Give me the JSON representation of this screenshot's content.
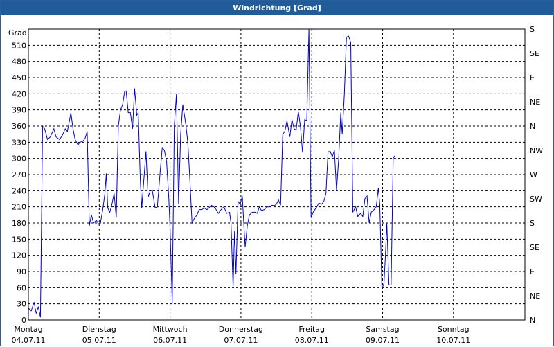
{
  "window": {
    "title": "Windrichtung [Grad]"
  },
  "chart_data": {
    "type": "line",
    "title": "Windrichtung [Grad]",
    "ylabel": "Grad",
    "ylim": [
      0,
      540
    ],
    "yticks": [
      0,
      30,
      60,
      90,
      120,
      150,
      180,
      210,
      240,
      270,
      300,
      330,
      360,
      390,
      420,
      450,
      480,
      510
    ],
    "right_ticks": [
      {
        "v": 0,
        "label": "N"
      },
      {
        "v": 45,
        "label": "NE"
      },
      {
        "v": 90,
        "label": "E"
      },
      {
        "v": 135,
        "label": "SE"
      },
      {
        "v": 180,
        "label": "S"
      },
      {
        "v": 225,
        "label": "SW"
      },
      {
        "v": 270,
        "label": "W"
      },
      {
        "v": 315,
        "label": "NW"
      },
      {
        "v": 360,
        "label": "N"
      },
      {
        "v": 405,
        "label": "NE"
      },
      {
        "v": 450,
        "label": "E"
      },
      {
        "v": 495,
        "label": "SE"
      },
      {
        "v": 540,
        "label": "S"
      }
    ],
    "xlim": [
      0,
      7
    ],
    "x_categories": [
      {
        "day": "Montag",
        "date": "04.07.11"
      },
      {
        "day": "Dienstag",
        "date": "05.07.11"
      },
      {
        "day": "Mittwoch",
        "date": "06.07.11"
      },
      {
        "day": "Donnerstag",
        "date": "07.07.11"
      },
      {
        "day": "Freitag",
        "date": "08.07.11"
      },
      {
        "day": "Samstag",
        "date": "09.07.11"
      },
      {
        "day": "Sonntag",
        "date": "10.07.11"
      }
    ],
    "grid": true,
    "color": "#0000cc",
    "series": [
      {
        "points": [
          [
            0.0,
            22
          ],
          [
            0.04,
            17
          ],
          [
            0.08,
            33
          ],
          [
            0.11,
            12
          ],
          [
            0.14,
            25
          ],
          [
            0.17,
            5
          ],
          [
            0.2,
            360
          ],
          [
            0.23,
            355
          ],
          [
            0.27,
            335
          ],
          [
            0.31,
            340
          ],
          [
            0.36,
            355
          ],
          [
            0.39,
            340
          ],
          [
            0.44,
            335
          ],
          [
            0.48,
            343
          ],
          [
            0.52,
            355
          ],
          [
            0.55,
            350
          ],
          [
            0.58,
            370
          ],
          [
            0.6,
            385
          ],
          [
            0.63,
            355
          ],
          [
            0.66,
            335
          ],
          [
            0.7,
            325
          ],
          [
            0.73,
            330
          ],
          [
            0.77,
            332
          ],
          [
            0.8,
            337
          ],
          [
            0.83,
            350
          ],
          [
            0.86,
            175
          ],
          [
            0.89,
            195
          ],
          [
            0.92,
            180
          ],
          [
            0.96,
            185
          ],
          [
            0.99,
            178
          ],
          [
            1.02,
            182
          ],
          [
            1.05,
            205
          ],
          [
            1.08,
            235
          ],
          [
            1.1,
            272
          ],
          [
            1.12,
            208
          ],
          [
            1.15,
            200
          ],
          [
            1.18,
            215
          ],
          [
            1.21,
            235
          ],
          [
            1.24,
            190
          ],
          [
            1.27,
            360
          ],
          [
            1.3,
            390
          ],
          [
            1.33,
            400
          ],
          [
            1.36,
            425
          ],
          [
            1.38,
            425
          ],
          [
            1.41,
            385
          ],
          [
            1.44,
            385
          ],
          [
            1.47,
            355
          ],
          [
            1.5,
            430
          ],
          [
            1.53,
            380
          ],
          [
            1.55,
            385
          ],
          [
            1.58,
            260
          ],
          [
            1.6,
            208
          ],
          [
            1.63,
            260
          ],
          [
            1.66,
            313
          ],
          [
            1.69,
            228
          ],
          [
            1.72,
            240
          ],
          [
            1.75,
            240
          ],
          [
            1.79,
            208
          ],
          [
            1.82,
            210
          ],
          [
            1.86,
            275
          ],
          [
            1.89,
            320
          ],
          [
            1.92,
            315
          ],
          [
            1.95,
            295
          ],
          [
            1.98,
            230
          ],
          [
            2.0,
            170
          ],
          [
            2.03,
            32
          ],
          [
            2.06,
            360
          ],
          [
            2.09,
            420
          ],
          [
            2.12,
            215
          ],
          [
            2.15,
            345
          ],
          [
            2.18,
            400
          ],
          [
            2.22,
            365
          ],
          [
            2.25,
            330
          ],
          [
            2.28,
            260
          ],
          [
            2.31,
            180
          ],
          [
            2.34,
            188
          ],
          [
            2.38,
            195
          ],
          [
            2.41,
            205
          ],
          [
            2.45,
            205
          ],
          [
            2.48,
            208
          ],
          [
            2.52,
            205
          ],
          [
            2.55,
            208
          ],
          [
            2.58,
            213
          ],
          [
            2.62,
            210
          ],
          [
            2.65,
            205
          ],
          [
            2.68,
            198
          ],
          [
            2.72,
            205
          ],
          [
            2.76,
            210
          ],
          [
            2.8,
            198
          ],
          [
            2.84,
            200
          ],
          [
            2.86,
            180
          ],
          [
            2.89,
            60
          ],
          [
            2.91,
            165
          ],
          [
            2.93,
            85
          ],
          [
            2.96,
            220
          ],
          [
            2.99,
            215
          ],
          [
            3.02,
            230
          ],
          [
            3.04,
            180
          ],
          [
            3.06,
            135
          ],
          [
            3.09,
            175
          ],
          [
            3.12,
            195
          ],
          [
            3.16,
            200
          ],
          [
            3.2,
            200
          ],
          [
            3.23,
            198
          ],
          [
            3.26,
            210
          ],
          [
            3.29,
            203
          ],
          [
            3.33,
            205
          ],
          [
            3.37,
            210
          ],
          [
            3.4,
            210
          ],
          [
            3.44,
            213
          ],
          [
            3.47,
            212
          ],
          [
            3.5,
            215
          ],
          [
            3.53,
            223
          ],
          [
            3.56,
            213
          ],
          [
            3.59,
            345
          ],
          [
            3.62,
            350
          ],
          [
            3.65,
            370
          ],
          [
            3.69,
            340
          ],
          [
            3.72,
            372
          ],
          [
            3.75,
            355
          ],
          [
            3.78,
            353
          ],
          [
            3.81,
            387
          ],
          [
            3.84,
            360
          ],
          [
            3.87,
            311
          ],
          [
            3.9,
            372
          ],
          [
            3.93,
            370
          ],
          [
            3.96,
            540
          ],
          [
            3.99,
            190
          ],
          [
            4.02,
            200
          ],
          [
            4.07,
            210
          ],
          [
            4.1,
            217
          ],
          [
            4.14,
            215
          ],
          [
            4.17,
            220
          ],
          [
            4.2,
            235
          ],
          [
            4.23,
            312
          ],
          [
            4.26,
            313
          ],
          [
            4.29,
            303
          ],
          [
            4.32,
            315
          ],
          [
            4.35,
            240
          ],
          [
            4.38,
            300
          ],
          [
            4.41,
            385
          ],
          [
            4.43,
            345
          ],
          [
            4.46,
            420
          ],
          [
            4.49,
            525
          ],
          [
            4.52,
            527
          ],
          [
            4.55,
            515
          ],
          [
            4.58,
            200
          ],
          [
            4.62,
            210
          ],
          [
            4.65,
            192
          ],
          [
            4.69,
            198
          ],
          [
            4.72,
            192
          ],
          [
            4.75,
            225
          ],
          [
            4.78,
            230
          ],
          [
            4.81,
            180
          ],
          [
            4.84,
            200
          ],
          [
            4.88,
            205
          ],
          [
            4.91,
            210
          ],
          [
            4.94,
            245
          ],
          [
            4.96,
            215
          ],
          [
            4.99,
            58
          ],
          [
            5.02,
            68
          ],
          [
            5.04,
            120
          ],
          [
            5.06,
            180
          ],
          [
            5.09,
            65
          ],
          [
            5.12,
            65
          ],
          [
            5.15,
            300
          ],
          [
            5.17,
            305
          ]
        ]
      }
    ]
  }
}
